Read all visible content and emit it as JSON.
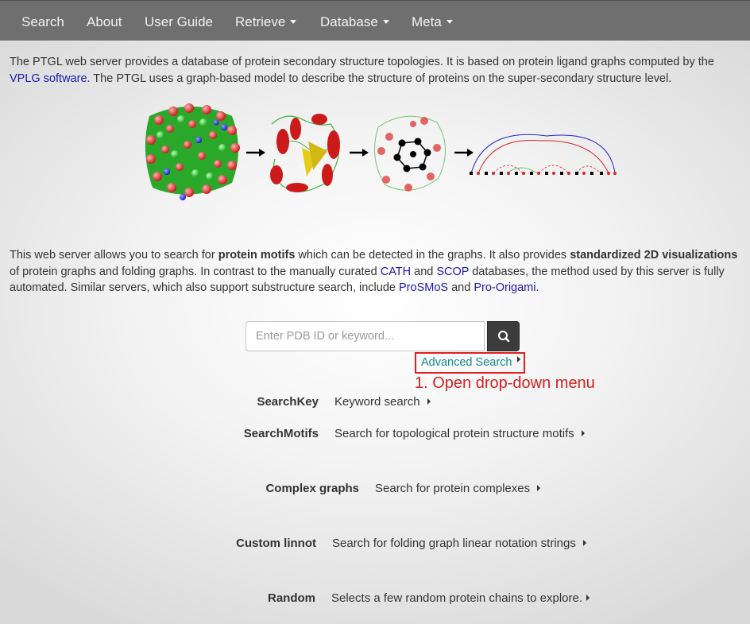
{
  "nav": {
    "search": "Search",
    "about": "About",
    "user_guide": "User Guide",
    "retrieve": "Retrieve",
    "database": "Database",
    "meta": "Meta"
  },
  "intro": {
    "t1": "The PTGL web server provides a database of protein secondary structure topologies. It is based on protein ligand graphs computed by the ",
    "link_vplg": "VPLG software",
    "t2": ". The PTGL uses a graph-based model to describe the structure of proteins on the super-secondary structure level."
  },
  "para2": {
    "t1": "This web server allows you to search for ",
    "b1": "protein motifs",
    "t2": " which can be detected in the graphs. It also provides ",
    "b2": "standardized 2D visualizations",
    "t3": " of protein graphs and folding graphs. In contrast to the manually curated ",
    "link_cath": "CATH",
    "t4": " and ",
    "link_scop": "SCOP",
    "t5": " databases, the method used by this server is fully automated. Similar servers, which also support substructure search, include ",
    "link_prosmos": "ProSMoS",
    "t6": " and ",
    "link_proorigami": "Pro-Origami",
    "t7": "."
  },
  "search": {
    "placeholder": "Enter PDB ID or keyword...",
    "advanced": "Advanced Search"
  },
  "annotation": "1. Open drop-down menu",
  "rows": [
    {
      "label": "SearchKey",
      "link": "Keyword search"
    },
    {
      "label": "SearchMotifs",
      "link": "Search for topological protein structure motifs"
    },
    {
      "label": "Complex graphs",
      "link": "Search for protein complexes"
    },
    {
      "label": "Custom linnot",
      "link": "Search for folding graph linear notation strings"
    },
    {
      "label": "Random",
      "link": "Selects a few random protein chains to explore."
    }
  ],
  "colors": {
    "navbar": "#6f6f6f",
    "link": "#1a1ab4",
    "advanced_link": "#158a8a",
    "annotation": "#d42020",
    "search_button": "#3c3c3c"
  }
}
